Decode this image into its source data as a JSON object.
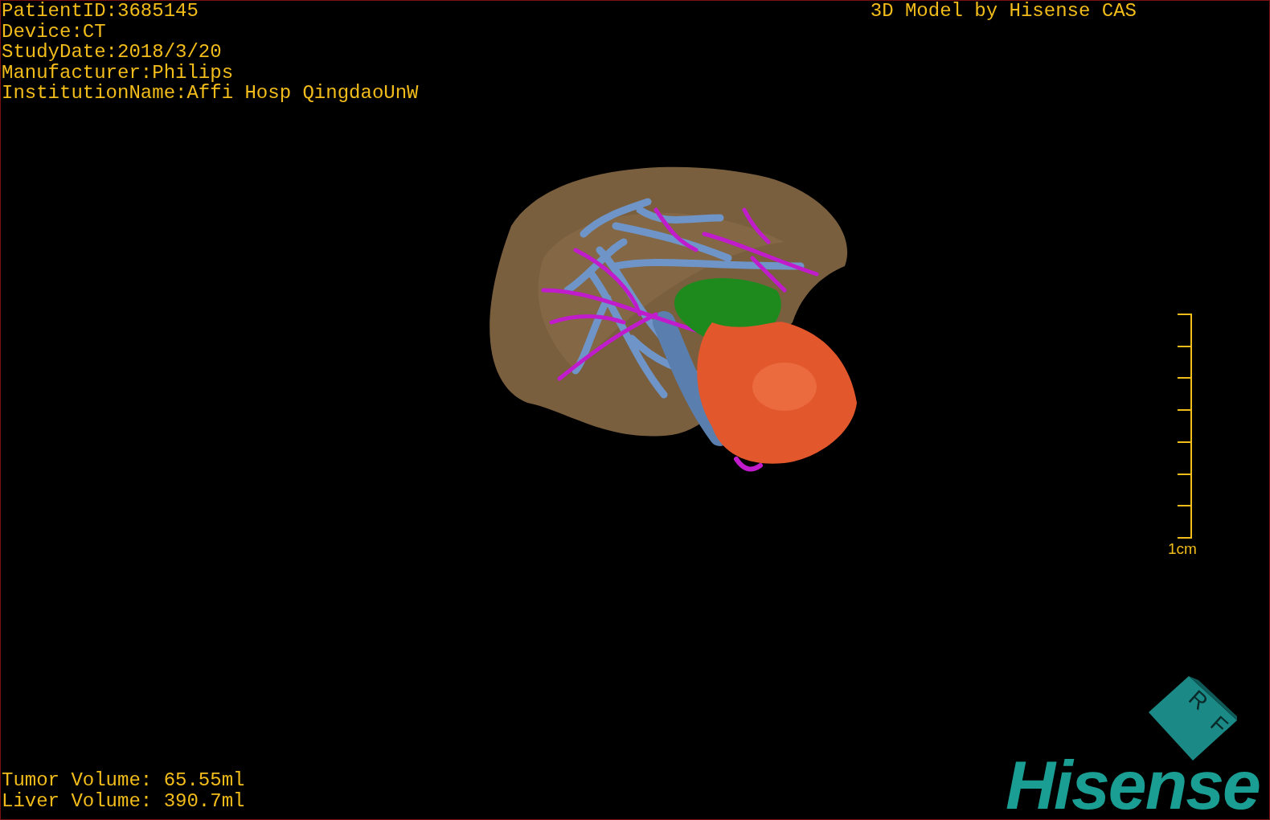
{
  "patient_info": [
    "PatientID:3685145",
    "Device:CT",
    "StudyDate:2018/3/20",
    "Manufacturer:Philips",
    "InstitutionName:Affi Hosp QingdaoUnW"
  ],
  "viewer_title": "3D Model by Hisense CAS",
  "scale_bar": {
    "label": "1cm"
  },
  "orientation_cube": {
    "faces": [
      "R",
      "F"
    ]
  },
  "logo": "Hisense",
  "volumes": [
    "Tumor Volume: 65.55ml",
    "Liver Volume: 390.7ml"
  ]
}
